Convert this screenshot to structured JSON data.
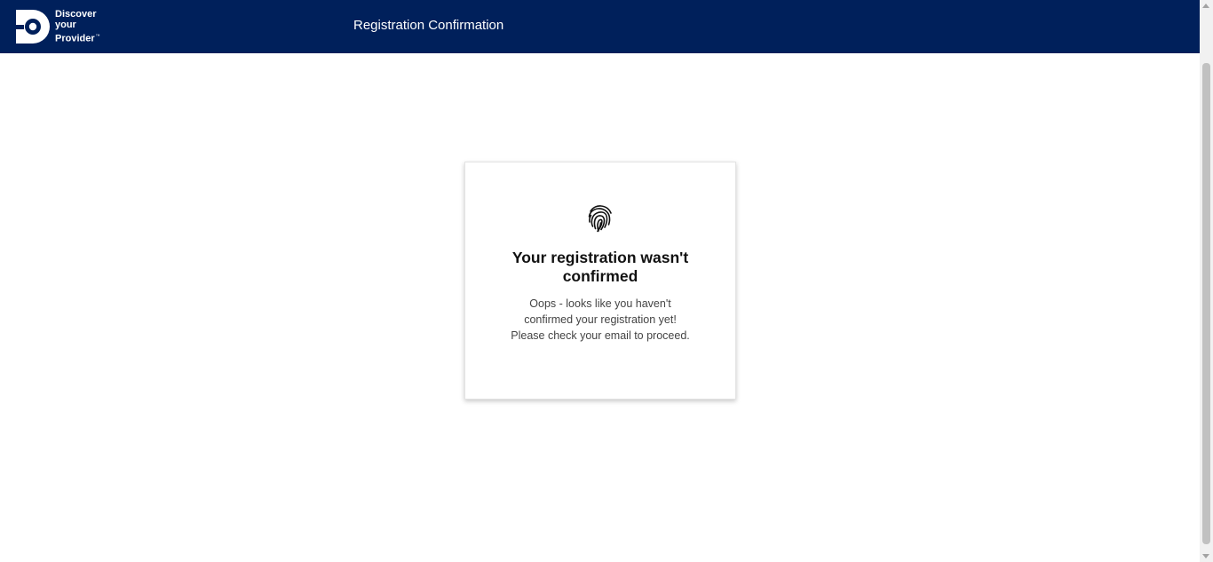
{
  "header": {
    "logo": {
      "line1": "Discover",
      "line2": "your",
      "line3": "Provider",
      "trademark": "™",
      "icon": "discover-your-provider-logo"
    },
    "title": "Registration Confirmation",
    "background_color": "#00205b"
  },
  "card": {
    "icon": "fingerprint-icon",
    "title": "Your registration wasn't confirmed",
    "message": "Oops - looks like you haven't confirmed your registration yet! Please check your email to proceed."
  },
  "scrollbar": {
    "icons": [
      "scroll-up-arrow",
      "scroll-down-arrow"
    ]
  }
}
